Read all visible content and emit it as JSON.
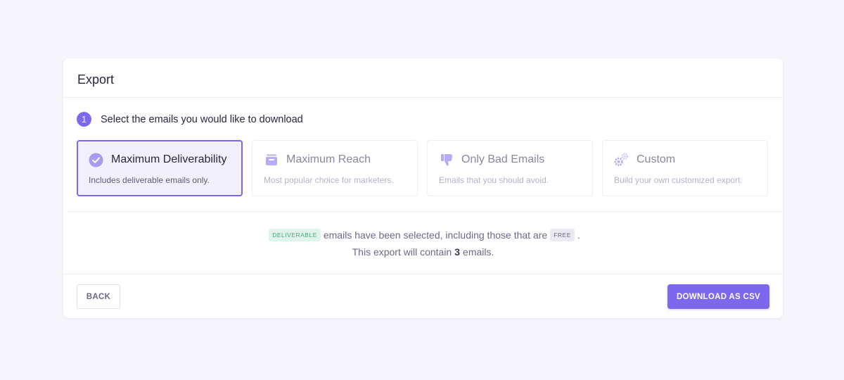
{
  "card": {
    "title": "Export"
  },
  "step": {
    "number": "1",
    "text": "Select the emails you would like to download"
  },
  "options": [
    {
      "title": "Maximum Deliverability",
      "description": "Includes deliverable emails only.",
      "icon": "check-circle-icon",
      "selected": true
    },
    {
      "title": "Maximum Reach",
      "description": "Most popular choice for marketers.",
      "icon": "inbox-icon",
      "selected": false
    },
    {
      "title": "Only Bad Emails",
      "description": "Emails that you should avoid.",
      "icon": "thumbs-down-icon",
      "selected": false
    },
    {
      "title": "Custom",
      "description": "Build your own customized export.",
      "icon": "gears-icon",
      "selected": false
    }
  ],
  "summary": {
    "badge_deliverable": "DELIVERABLE",
    "line1_middle": "emails have been selected, including those that are",
    "badge_free": "FREE",
    "line1_end": ".",
    "line2_prefix": "This export will contain",
    "count": "3",
    "line2_suffix": "emails."
  },
  "footer": {
    "back_label": "BACK",
    "download_label": "DOWNLOAD AS CSV"
  },
  "colors": {
    "accent": "#7b68ee",
    "deliverable_badge": "#e1f4ec",
    "free_badge": "#ebeaf2"
  }
}
